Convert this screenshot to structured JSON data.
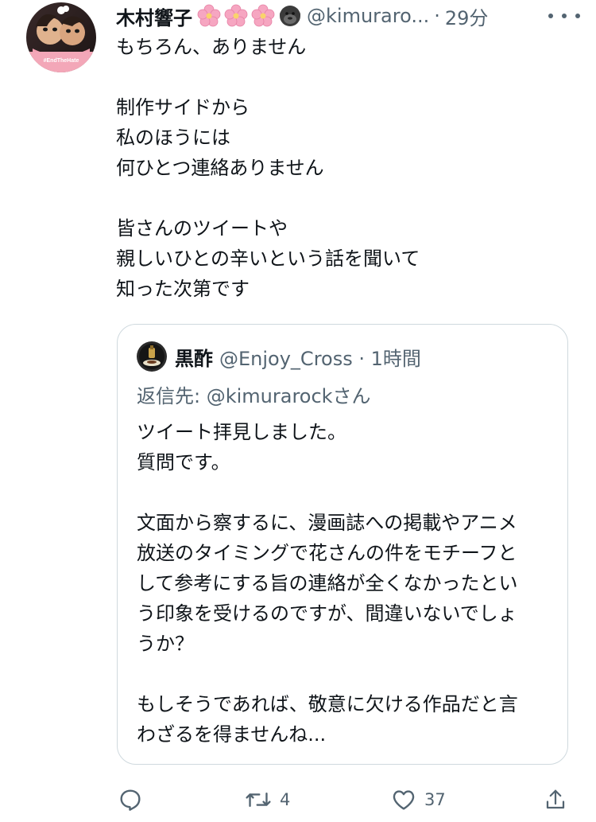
{
  "tweet": {
    "display_name": "木村響子",
    "name_emojis": [
      "cherry-blossom-icon",
      "cherry-blossom-icon",
      "cherry-blossom-icon",
      "gorilla-icon"
    ],
    "handle": "@kimuraro...",
    "separator": "·",
    "timestamp": "29分",
    "avatar_badge": "#EndTheHate",
    "lines": [
      "もちろん、ありません",
      "",
      "制作サイドから",
      "私のほうには",
      "何ひとつ連絡ありません",
      "",
      "皆さんのツイートや",
      "親しいひとの辛いという話を聞いて",
      "知った次第です"
    ]
  },
  "quote": {
    "display_name": "黒酢",
    "handle_meta": "@Enjoy_Cross · 1時間",
    "reply_to": "返信先: @kimurarockさん",
    "lines": [
      "ツイート拝見しました。",
      "質問です。",
      "",
      "文面から察するに、漫画誌への掲載やアニメ",
      "放送のタイミングで花さんの件をモチーフと",
      "して参考にする旨の連絡が全くなかったとい",
      "う印象を受けるのですが、間違いないでしょ",
      "うか？",
      "",
      "もしそうであれば、敬意に欠ける作品だと言",
      "わざるを得ませんね..."
    ]
  },
  "actions": {
    "reply_count": "",
    "retweet_count": "4",
    "like_count": "37",
    "share_count": ""
  },
  "colors": {
    "text": "#0f1419",
    "secondary": "#536471",
    "border": "#cfd9de",
    "blossom": "#f6a6c1"
  }
}
